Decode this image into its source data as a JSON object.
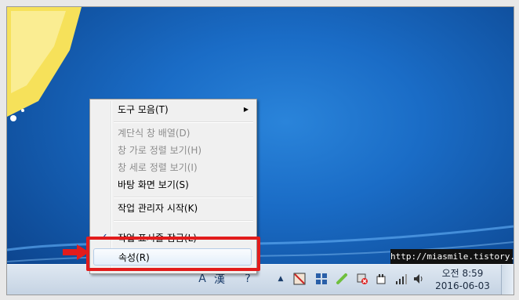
{
  "context_menu": {
    "items": [
      {
        "label": "도구 모음(T)",
        "enabled": true,
        "submenu": true
      },
      {
        "label": "계단식 창 배열(D)",
        "enabled": false
      },
      {
        "label": "창 가로 정렬 보기(H)",
        "enabled": false
      },
      {
        "label": "창 세로 정렬 보기(I)",
        "enabled": false
      },
      {
        "label": "바탕 화면 보기(S)",
        "enabled": true
      },
      {
        "label": "작업 관리자 시작(K)",
        "enabled": true
      },
      {
        "label": "작업 표시줄 잠금(L)",
        "enabled": true,
        "checked": true
      },
      {
        "label": "속성(R)",
        "enabled": true,
        "highlighted": true
      }
    ],
    "check_mark": "✓",
    "submenu_arrow": "▶"
  },
  "watermark": "http://miasmile.tistory.com",
  "clock": {
    "period_time": "오전 8:59",
    "date": "2016-06-03"
  },
  "tray": {
    "expand_arrow": "▲",
    "icons": [
      "ime-icon",
      "hangul-icon",
      "action-center-icon",
      "windows-icon",
      "pen-icon",
      "network-error-icon",
      "power-icon",
      "signal-icon",
      "volume-icon"
    ]
  },
  "colors": {
    "highlight_red": "#e21c1c",
    "desktop_blue": "#1a6cc6"
  }
}
